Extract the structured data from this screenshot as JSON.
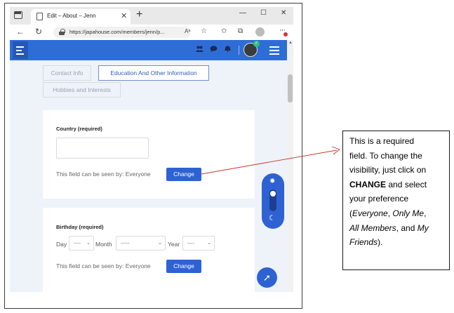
{
  "browser": {
    "tab_title": "Edit – About – Jenn",
    "tab_close": "✕",
    "new_tab": "+",
    "url": "https://japahouse.com/members/jenn/p...",
    "window_controls": {
      "minimize": "—",
      "maximize": "☐",
      "close": "✕"
    }
  },
  "icons": {
    "tab_actions": "tab-actions-icon",
    "back": "back-arrow-icon",
    "refresh": "refresh-icon",
    "lock": "lock-icon",
    "read_aloud": "read-aloud-icon",
    "add_favorite": "star-plus-icon",
    "favorites": "favorites-icon",
    "collections": "collections-icon",
    "profile": "profile-icon",
    "more": "more-dots-icon",
    "friends": "friends-icon",
    "messages": "messages-icon",
    "notifications": "notifications-icon",
    "sun": "sun-icon",
    "moon": "moon-icon",
    "scroll_top": "arrow-up-icon"
  },
  "colors": {
    "brand_blue": "#2e6dd6",
    "button_blue": "#2e62d2",
    "online_green": "#2ec27e",
    "content_bg": "#eef2f9",
    "arrow_red": "#c0392b"
  },
  "profile_tabs": [
    {
      "label": "Contact Info",
      "active": false
    },
    {
      "label": "Education And Other Information",
      "active": true
    },
    {
      "label": "Hobbies and Interests",
      "active": false
    }
  ],
  "country_card": {
    "label": "Country (required)",
    "value": "",
    "visibility_text": "This field can be seen by: Everyone",
    "change_label": "Change"
  },
  "birthday_card": {
    "label": "Birthday (required)",
    "day_label": "Day",
    "day_value": "----",
    "month_label": "Month",
    "month_value": "-----",
    "year_label": "Year",
    "year_value": "----",
    "visibility_text": "This field can be seen by: Everyone",
    "change_label": "Change"
  },
  "theme_switch": {
    "mode": "light"
  },
  "callout": {
    "line1": "This is a required",
    "line2": "field. To change the",
    "line3": "visibility, just click on",
    "line4_bold": "CHANGE",
    "line4_rest": " and select",
    "line5": "your preference",
    "line6_a": "(",
    "line6_b": "Everyone",
    "line6_c": ", ",
    "line6_d": "Only Me",
    "line6_e": ",",
    "line7_a": "All Members",
    "line7_b": ", and ",
    "line7_c": "My",
    "line8_a": "Friends",
    "line8_b": ")."
  }
}
